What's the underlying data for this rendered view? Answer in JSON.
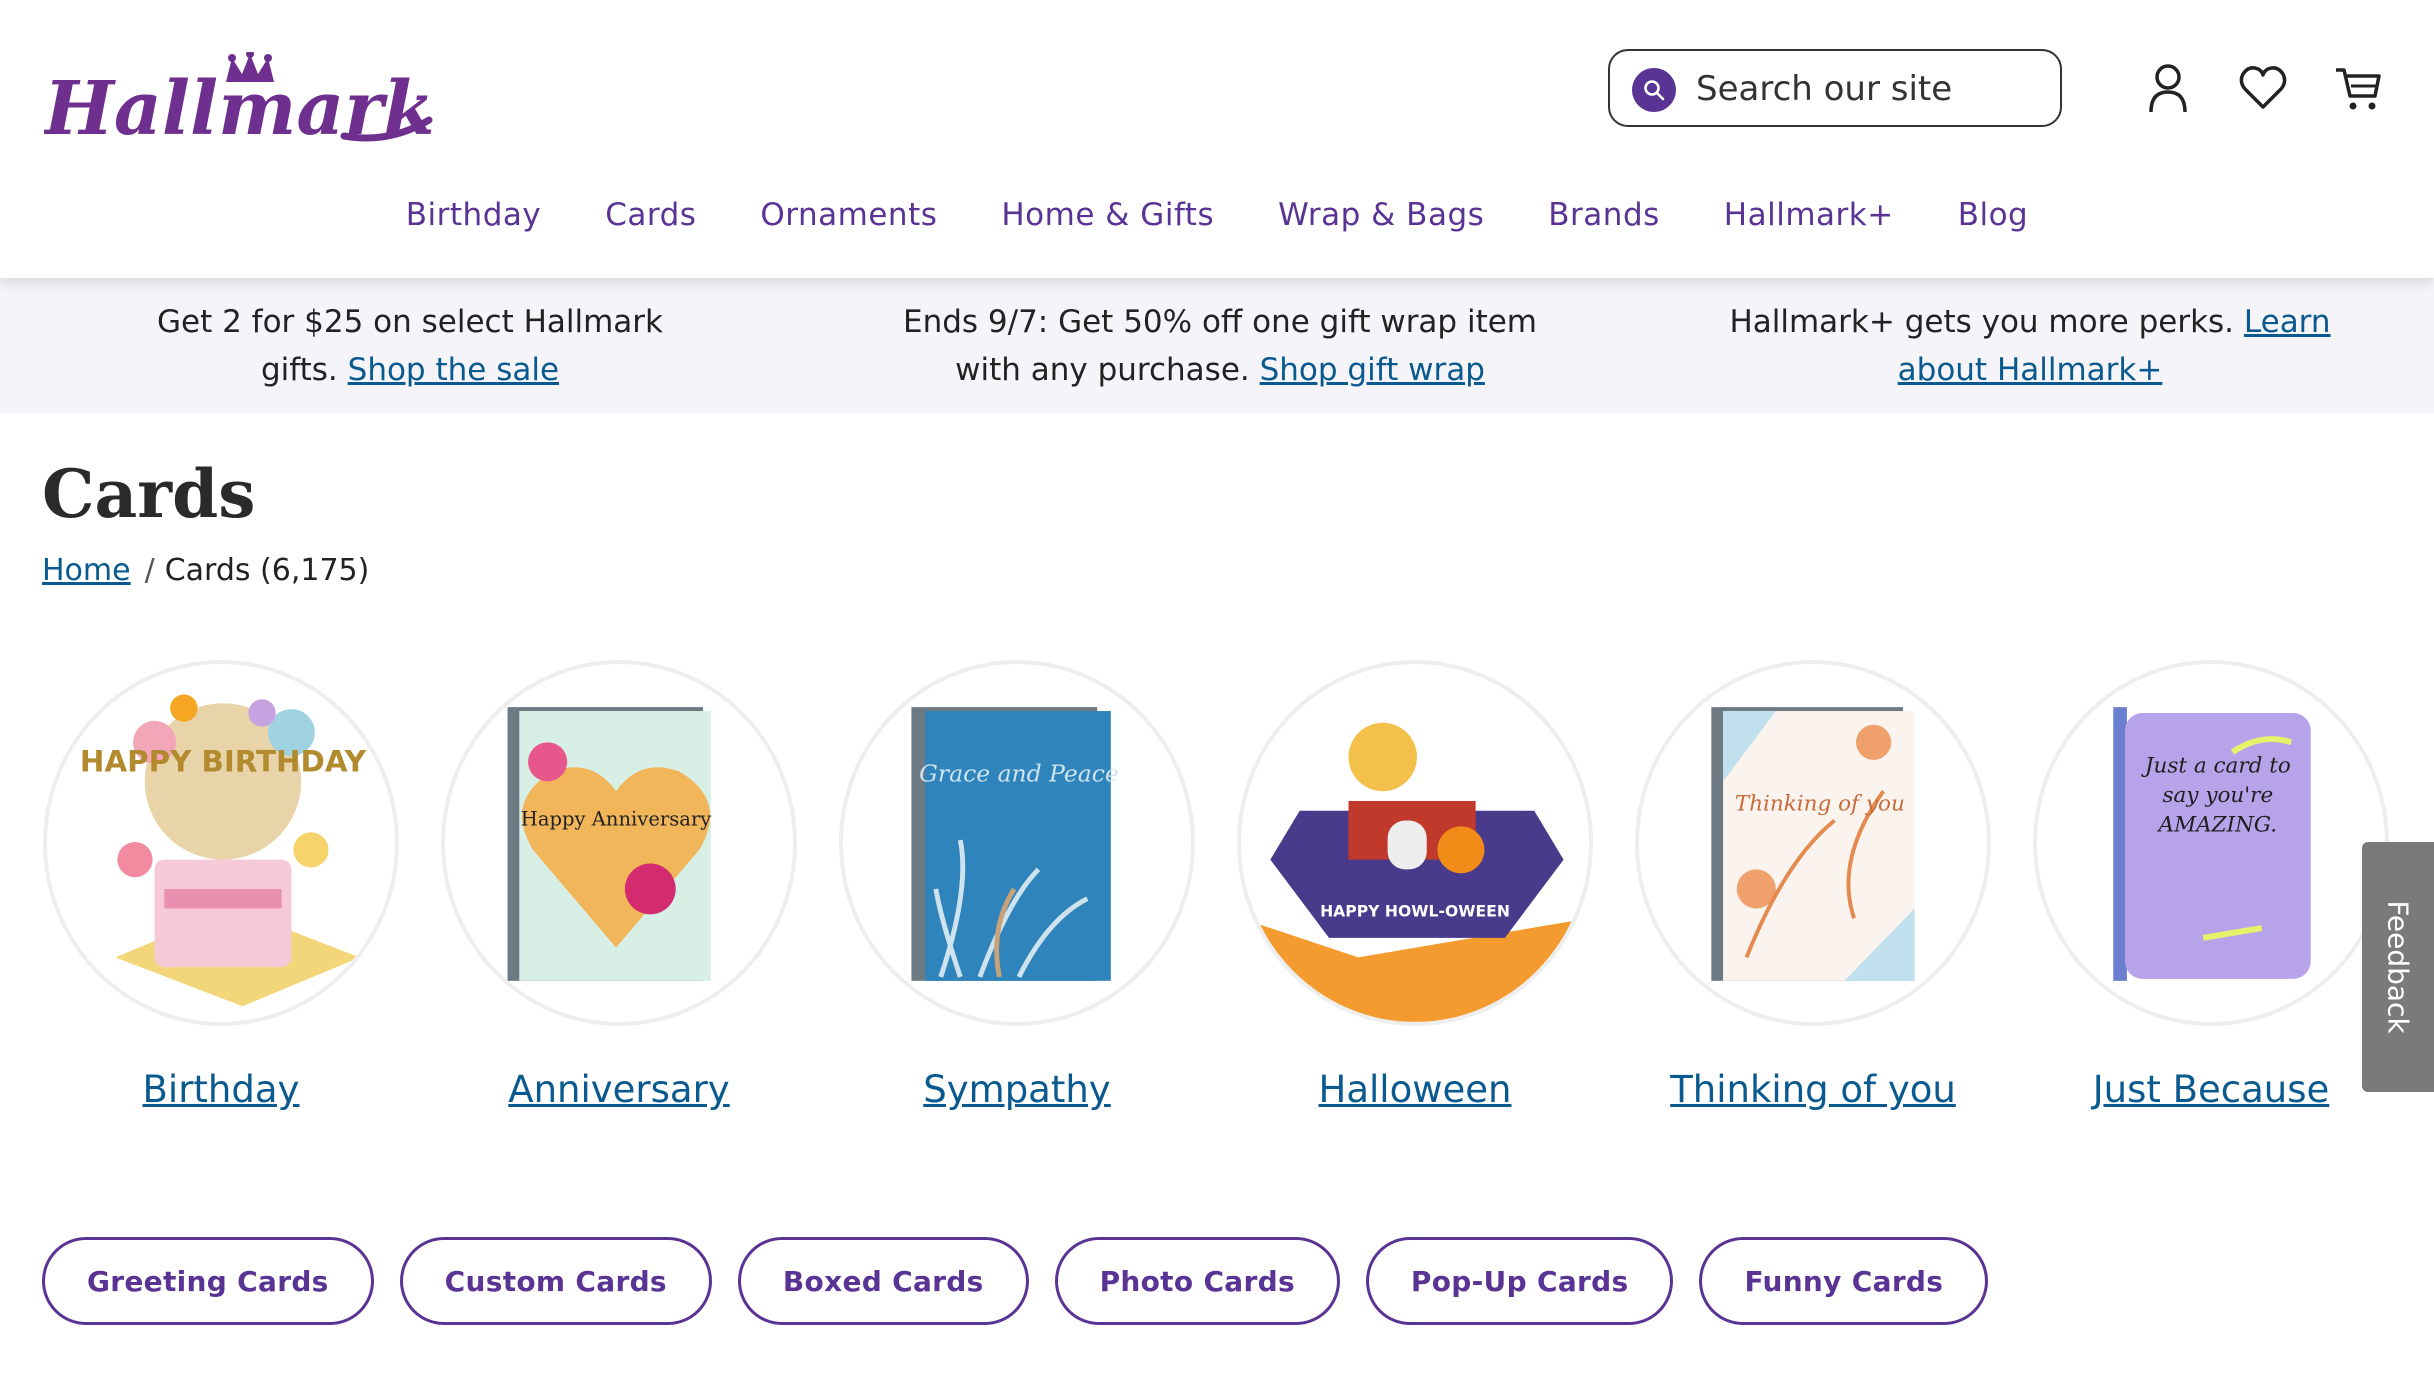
{
  "brand": {
    "logo_text": "Hallmark",
    "primary_color": "#5a3494",
    "link_color": "#0a5a8f"
  },
  "search": {
    "placeholder": "Search our site"
  },
  "header_icons": [
    "account-icon",
    "heart-icon",
    "cart-icon"
  ],
  "nav": [
    "Birthday",
    "Cards",
    "Ornaments",
    "Home & Gifts",
    "Wrap & Bags",
    "Brands",
    "Hallmark+",
    "Blog"
  ],
  "promos": [
    {
      "text": "Get 2 for $25 on select Hallmark gifts. ",
      "link": "Shop the sale"
    },
    {
      "text": "Ends 9/7: Get 50% off one gift wrap item with any purchase. ",
      "link": "Shop gift wrap"
    },
    {
      "text": "Hallmark+ gets you more perks. ",
      "link": "Learn about Hallmark+"
    }
  ],
  "page": {
    "title": "Cards",
    "breadcrumb": {
      "home": "Home",
      "sep": "/",
      "current": "Cards (6,175)"
    }
  },
  "categories": [
    {
      "label": "Birthday",
      "card_text": "HAPPY BIRTHDAY"
    },
    {
      "label": "Anniversary",
      "card_text": "Happy Anniversary"
    },
    {
      "label": "Sympathy",
      "card_text": "Grace and Peace"
    },
    {
      "label": "Halloween",
      "card_text": "HAPPY HOWL-OWEEN"
    },
    {
      "label": "Thinking of you",
      "card_text": "Thinking of you"
    },
    {
      "label": "Just Because",
      "card_text": "Just a card to say you're AMAZING."
    }
  ],
  "filters": [
    "Greeting Cards",
    "Custom Cards",
    "Boxed Cards",
    "Photo Cards",
    "Pop-Up Cards",
    "Funny Cards"
  ],
  "feedback_label": "Feedback"
}
